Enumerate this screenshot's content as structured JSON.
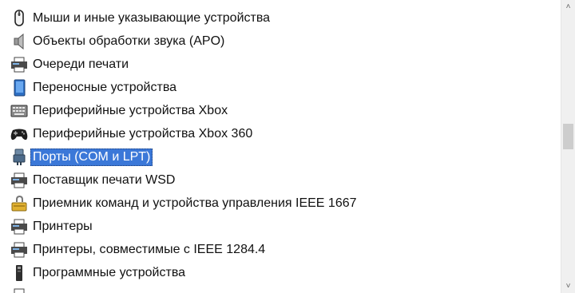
{
  "device_tree": {
    "items": [
      {
        "label": "Мыши и иные указывающие устройства",
        "icon": "mouse-icon"
      },
      {
        "label": "Объекты обработки звука (APO)",
        "icon": "speaker-icon"
      },
      {
        "label": "Очереди печати",
        "icon": "printer-icon"
      },
      {
        "label": "Переносные устройства",
        "icon": "portable-device-icon"
      },
      {
        "label": "Периферийные устройства Xbox",
        "icon": "xbox-peripheral-icon"
      },
      {
        "label": "Периферийные устройства Xbox 360",
        "icon": "gamepad-icon"
      },
      {
        "label": "Порты (COM и LPT)",
        "icon": "port-icon",
        "selected": true
      },
      {
        "label": "Поставщик печати WSD",
        "icon": "printer-icon"
      },
      {
        "label": "Приемник команд и устройства управления IEEE 1667",
        "icon": "security-device-icon"
      },
      {
        "label": "Принтеры",
        "icon": "printer-icon"
      },
      {
        "label": "Принтеры, совместимые с IEEE 1284.4",
        "icon": "printer-icon"
      },
      {
        "label": "Программные устройства",
        "icon": "software-device-icon"
      },
      {
        "label": "",
        "icon": "printer-icon"
      }
    ]
  },
  "scrollbar": {
    "up_arrow": "˄",
    "down_arrow": "˅"
  },
  "colors": {
    "selection": "#3b78d8",
    "selection_text": "#ffffff",
    "text": "#111111"
  }
}
